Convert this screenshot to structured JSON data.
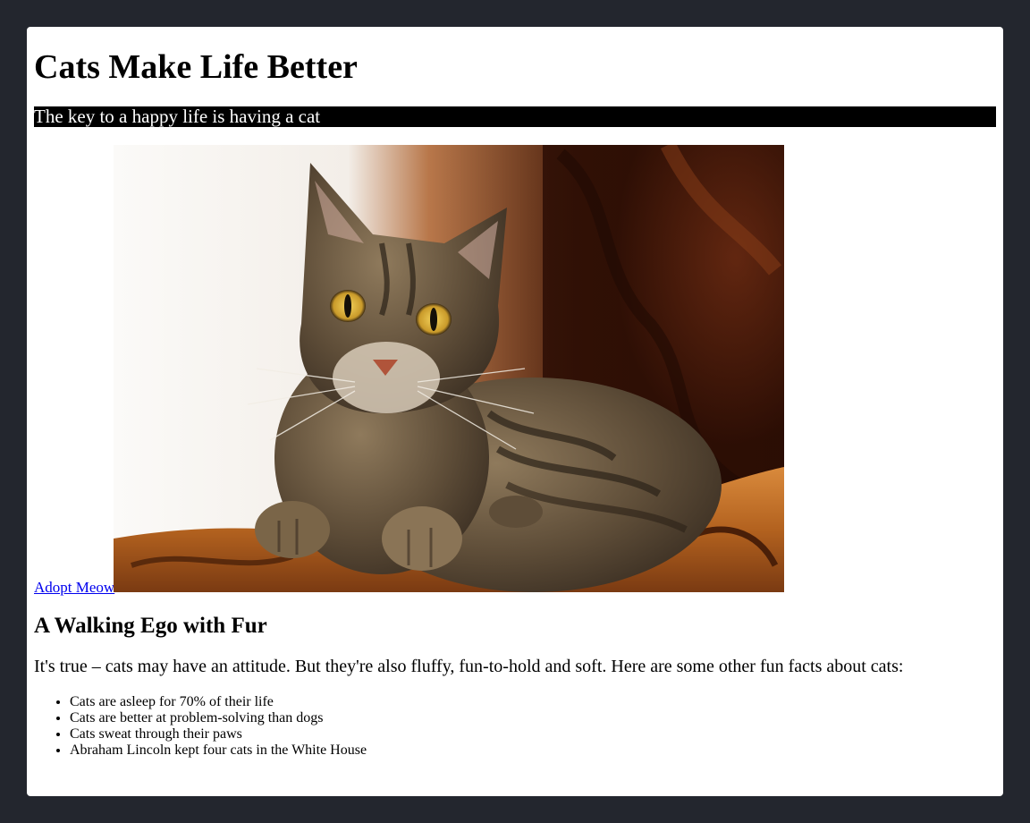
{
  "page": {
    "title": "Cats Make Life Better",
    "tagline": "The key to a happy life is having a cat",
    "adopt_link": "Adopt Meow",
    "image_subject": "tabby-cat-photo",
    "section_heading": "A Walking Ego with Fur",
    "intro": "It's true – cats may have an attitude. But they're also fluffy, fun-to-hold and soft. Here are some other fun facts about cats:",
    "facts": [
      "Cats are asleep for 70% of their life",
      "Cats are better at problem-solving than dogs",
      "Cats sweat through their paws",
      "Abraham Lincoln kept four cats in the White House"
    ]
  },
  "colors": {
    "backdrop": "#23262e",
    "page": "#ffffff",
    "tagline_bg": "#000000",
    "tagline_text": "#ffffff",
    "link": "#0000ee"
  }
}
